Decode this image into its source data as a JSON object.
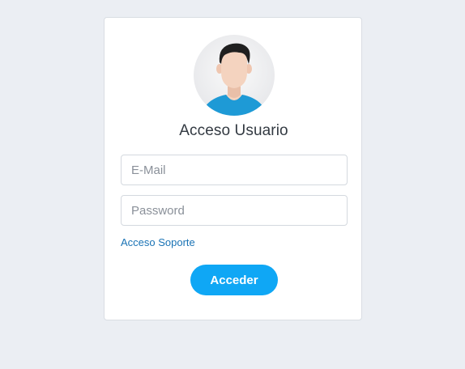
{
  "login": {
    "title": "Acceso Usuario",
    "email_placeholder": "E-Mail",
    "password_placeholder": "Password",
    "support_link": "Acceso Soporte",
    "submit_label": "Acceder"
  },
  "avatar": {
    "icon": "user-avatar-icon",
    "shirt_color": "#1e9ad6",
    "skin_color": "#f4d3bf",
    "hair_color": "#1f1f1f"
  },
  "colors": {
    "background": "#ebeef3",
    "card": "#ffffff",
    "link": "#1a73b5",
    "button": "#0fa7f5"
  }
}
